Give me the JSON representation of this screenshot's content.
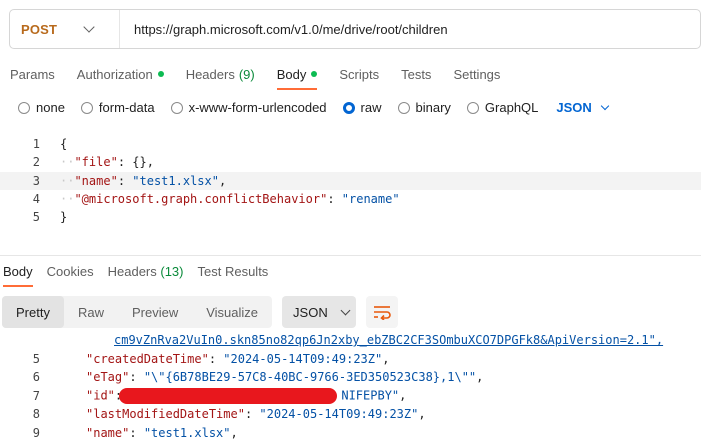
{
  "request": {
    "method": "POST",
    "url": "https://graph.microsoft.com/v1.0/me/drive/root/children"
  },
  "request_tabs": [
    {
      "label": "Params"
    },
    {
      "label": "Authorization"
    },
    {
      "label": "Headers",
      "count": "(9)"
    },
    {
      "label": "Body"
    },
    {
      "label": "Scripts"
    },
    {
      "label": "Tests"
    },
    {
      "label": "Settings"
    }
  ],
  "body_types": {
    "none": "none",
    "form_data": "form-data",
    "urlencoded": "x-www-form-urlencoded",
    "raw": "raw",
    "binary": "binary",
    "graphql": "GraphQL",
    "format": "JSON"
  },
  "editor": {
    "lines": [
      {
        "n": "1",
        "parts": [
          {
            "t": "{",
            "c": ""
          }
        ]
      },
      {
        "n": "2",
        "parts": [
          {
            "t": "··",
            "c": "dots"
          },
          {
            "t": "\"file\"",
            "c": "key"
          },
          {
            "t": ": {},",
            "c": ""
          }
        ]
      },
      {
        "n": "3",
        "parts": [
          {
            "t": "··",
            "c": "dots"
          },
          {
            "t": "\"name\"",
            "c": "key"
          },
          {
            "t": ": ",
            "c": ""
          },
          {
            "t": "\"test1.xlsx\"",
            "c": "str"
          },
          {
            "t": ",",
            "c": ""
          }
        ]
      },
      {
        "n": "4",
        "parts": [
          {
            "t": "··",
            "c": "dots"
          },
          {
            "t": "\"@microsoft.graph.conflictBehavior\"",
            "c": "key"
          },
          {
            "t": ": ",
            "c": ""
          },
          {
            "t": "\"rename\"",
            "c": "str"
          }
        ]
      },
      {
        "n": "5",
        "parts": [
          {
            "t": "}",
            "c": ""
          }
        ]
      }
    ]
  },
  "response_tabs": [
    {
      "label": "Body"
    },
    {
      "label": "Cookies"
    },
    {
      "label": "Headers",
      "count": "(13)"
    },
    {
      "label": "Test Results"
    }
  ],
  "view_modes": {
    "pretty": "Pretty",
    "raw": "Raw",
    "preview": "Preview",
    "visualize": "Visualize",
    "format": "JSON"
  },
  "response": {
    "link_line": "cm9vZnRva2VuIn0.skn85no82qp6Jn2xby_ebZBC2CF3SOmbuXCO7DPGFk8&ApiVersion=2.1\",",
    "lines": [
      {
        "n": "5",
        "key": "\"createdDateTime\"",
        "val": "\"2024-05-14T09:49:23Z\"",
        "end": ","
      },
      {
        "n": "6",
        "key": "\"eTag\"",
        "val": "\"\\\"{6B78BE29-57C8-40BC-9766-3ED350523C38},1\\\"\"",
        "end": ","
      },
      {
        "n": "7",
        "key": "\"id\"",
        "val": "\"NIFEPBY\"",
        "end": ","
      },
      {
        "n": "8",
        "key": "\"lastModifiedDateTime\"",
        "val": "\"2024-05-14T09:49:23Z\"",
        "end": ","
      },
      {
        "n": "9",
        "key": "\"name\"",
        "val": "\"test1.xlsx\"",
        "end": ","
      }
    ]
  },
  "colors": {
    "accent_tab": "#ff6c37",
    "method": "#b86a1c",
    "radio_selected": "#0265d2",
    "status_dot": "#0cbb52",
    "redaction": "#e8171d"
  }
}
